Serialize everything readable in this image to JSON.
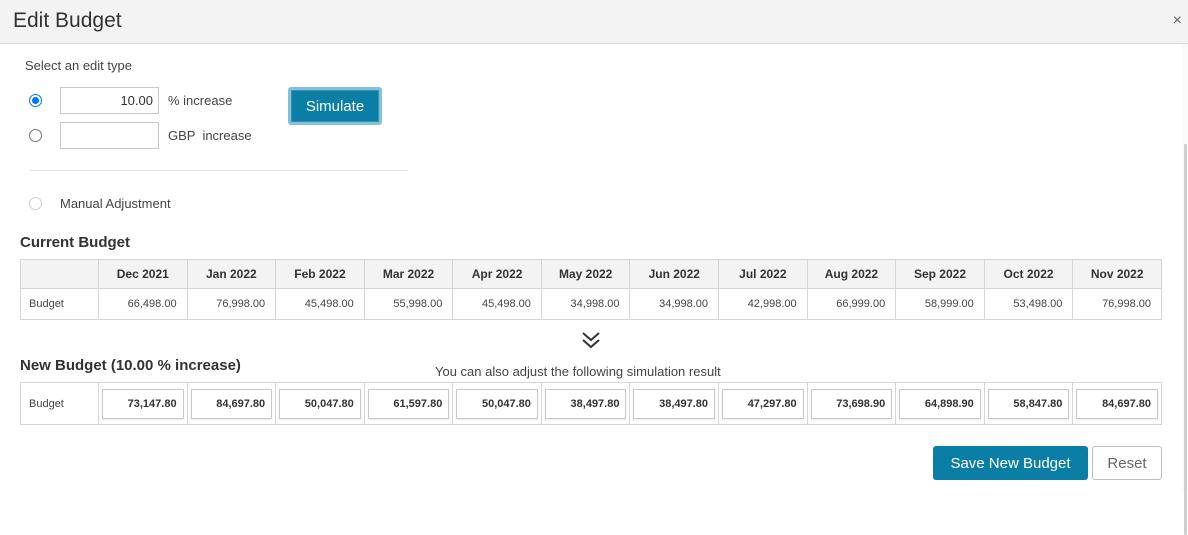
{
  "dialog": {
    "title": "Edit Budget",
    "close_glyph": "×"
  },
  "edit_type": {
    "label": "Select an edit type",
    "percent": {
      "value": "10.00",
      "label": "% increase",
      "selected": true
    },
    "gbp": {
      "value": "",
      "label": "GBP  increase",
      "selected": false
    },
    "simulate_label": "Simulate",
    "manual_label": "Manual Adjustment"
  },
  "current_budget": {
    "title": "Current Budget",
    "row_label": "Budget",
    "months": [
      "Dec 2021",
      "Jan 2022",
      "Feb 2022",
      "Mar 2022",
      "Apr 2022",
      "May 2022",
      "Jun 2022",
      "Jul 2022",
      "Aug 2022",
      "Sep 2022",
      "Oct 2022",
      "Nov 2022"
    ],
    "values": [
      "66,498.00",
      "76,998.00",
      "45,498.00",
      "55,998.00",
      "45,498.00",
      "34,998.00",
      "34,998.00",
      "42,998.00",
      "66,999.00",
      "58,999.00",
      "53,498.00",
      "76,998.00"
    ]
  },
  "chevron_icon": "double-chevron-down-icon",
  "new_budget": {
    "title": "New Budget (10.00 % increase)",
    "hint": "You can also adjust the following simulation result",
    "row_label": "Budget",
    "values": [
      "73,147.80",
      "84,697.80",
      "50,047.80",
      "61,597.80",
      "50,047.80",
      "38,497.80",
      "38,497.80",
      "47,297.80",
      "73,698.90",
      "64,898.90",
      "58,847.80",
      "84,697.80"
    ]
  },
  "actions": {
    "save_label": "Save New Budget",
    "reset_label": "Reset"
  },
  "colors": {
    "primary": "#0a7ea4",
    "radio_accent": "#0075ff",
    "header_bg": "#f3f3f3"
  }
}
